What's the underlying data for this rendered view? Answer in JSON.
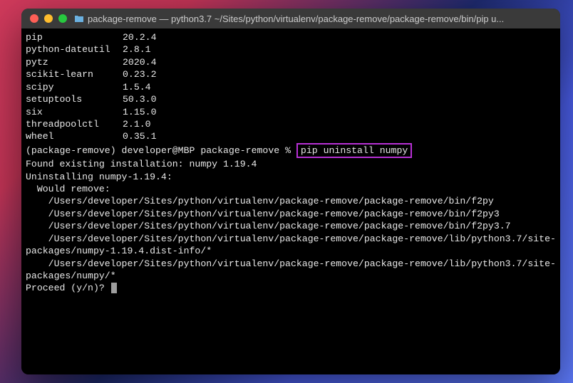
{
  "titlebar": {
    "title": "package-remove — python3.7 ~/Sites/python/virtualenv/package-remove/package-remove/bin/pip u..."
  },
  "packages": [
    {
      "name": "pip",
      "version": "20.2.4"
    },
    {
      "name": "python-dateutil",
      "version": "2.8.1"
    },
    {
      "name": "pytz",
      "version": "2020.4"
    },
    {
      "name": "scikit-learn",
      "version": "0.23.2"
    },
    {
      "name": "scipy",
      "version": "1.5.4"
    },
    {
      "name": "setuptools",
      "version": "50.3.0"
    },
    {
      "name": "six",
      "version": "1.15.0"
    },
    {
      "name": "threadpoolctl",
      "version": "2.1.0"
    },
    {
      "name": "wheel",
      "version": "0.35.1"
    }
  ],
  "prompt": {
    "env": "(package-remove)",
    "userhost": "developer@MBP",
    "cwd": "package-remove",
    "symbol": "%",
    "command": "pip uninstall numpy"
  },
  "output": {
    "found": "Found existing installation: numpy 1.19.4",
    "uninstalling": "Uninstalling numpy-1.19.4:",
    "would_remove": "  Would remove:",
    "paths": [
      "    /Users/developer/Sites/python/virtualenv/package-remove/package-remove/bin/f2py",
      "    /Users/developer/Sites/python/virtualenv/package-remove/package-remove/bin/f2py3",
      "    /Users/developer/Sites/python/virtualenv/package-remove/package-remove/bin/f2py3.7",
      "    /Users/developer/Sites/python/virtualenv/package-remove/package-remove/lib/python3.7/site-packages/numpy-1.19.4.dist-info/*",
      "    /Users/developer/Sites/python/virtualenv/package-remove/package-remove/lib/python3.7/site-packages/numpy/*"
    ],
    "proceed": "Proceed (y/n)? "
  }
}
